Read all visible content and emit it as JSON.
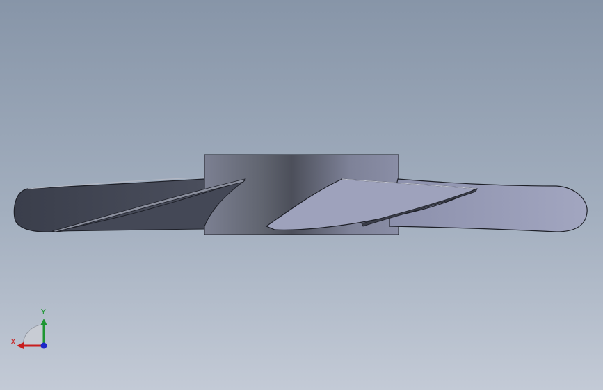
{
  "viewport": {
    "background_top": "#8795a8",
    "background_bottom": "#c3cad6"
  },
  "model": {
    "hub_color": "#6e7282",
    "blade_dark_color": "#3d4250",
    "blade_light_color": "#9a9eb8",
    "edge_color": "#1e2028"
  },
  "triad": {
    "x_label": "X",
    "y_label": "Y",
    "x_color": "#c81e1e",
    "y_color": "#1e9632",
    "z_color": "#1e28c8"
  }
}
